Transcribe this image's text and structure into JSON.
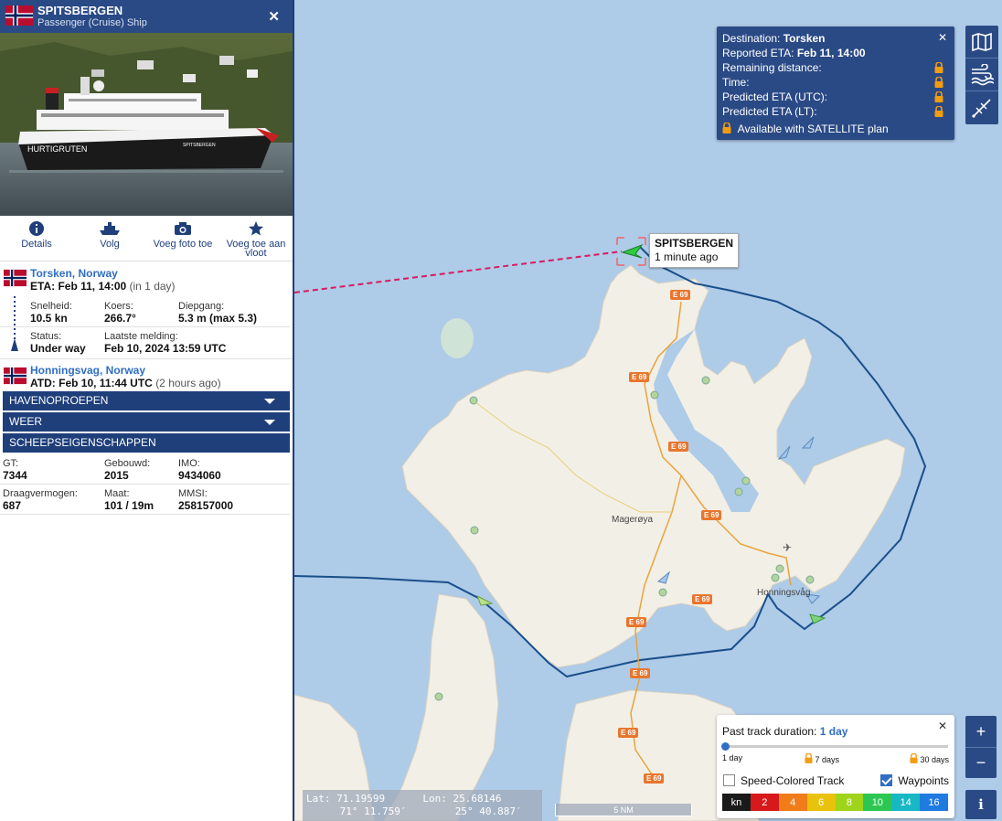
{
  "ship": {
    "name": "SPITSBERGEN",
    "type": "Passenger (Cruise) Ship",
    "photo_text_hull": "HURTIGRUTEN",
    "photo_text_name": "SPITSBERGEN"
  },
  "actions": [
    {
      "label": "Details",
      "icon": "info-icon"
    },
    {
      "label": "Volg",
      "icon": "ship-icon"
    },
    {
      "label": "Voeg foto toe",
      "icon": "camera-icon"
    },
    {
      "label": "Voeg toe aan vloot",
      "icon": "star-icon"
    }
  ],
  "destination": {
    "port": "Torsken, Norway",
    "eta_label": "ETA:",
    "eta": "Feb 11, 14:00",
    "eta_rel": "(in 1 day)"
  },
  "voyage": {
    "speed_label": "Snelheid:",
    "speed": "10.5 kn",
    "course_label": "Koers:",
    "course": "266.7°",
    "draught_label": "Diepgang:",
    "draught": "5.3 m (max 5.3)",
    "status_label": "Status:",
    "status": "Under way",
    "last_label": "Laatste melding:",
    "last": "Feb 10, 2024 13:59 UTC"
  },
  "departure": {
    "port": "Honningsvag, Norway",
    "atd_label": "ATD:",
    "atd": "Feb 10, 11:44 UTC",
    "atd_rel": "(2 hours ago)"
  },
  "sections": {
    "port_calls": "HAVENOPROEPEN",
    "weather": "WEER",
    "properties": "SCHEEPSEIGENSCHAPPEN"
  },
  "properties": {
    "gt_label": "GT:",
    "gt": "7344",
    "built_label": "Gebouwd:",
    "built": "2015",
    "imo_label": "IMO:",
    "imo": "9434060",
    "dwt_label": "Draagvermogen:",
    "dwt": "687",
    "size_label": "Maat:",
    "size": "101 / 19m",
    "mmsi_label": "MMSI:",
    "mmsi": "258157000"
  },
  "map_label": {
    "name": "SPITSBERGEN",
    "time": "1 minute ago"
  },
  "places": {
    "mageroya": "Magerøya",
    "honningsvag": "Honningsvåg",
    "road": "E 69"
  },
  "popup": {
    "dest_label": "Destination:",
    "dest": "Torsken",
    "eta_label": "Reported ETA:",
    "eta": "Feb 11, 14:00",
    "remaining": "Remaining distance:",
    "time": "Time:",
    "pred_utc": "Predicted ETA (UTC):",
    "pred_lt": "Predicted ETA (LT):",
    "plan": "Available with SATELLITE plan"
  },
  "track": {
    "title": "Past track duration:",
    "value": "1 day",
    "stop1": "1 day",
    "stop7": "7 days",
    "stop30": "30 days",
    "speed_colored": "Speed-Colored Track",
    "waypoints": "Waypoints",
    "legend": [
      "kn",
      "2",
      "4",
      "6",
      "8",
      "10",
      "14",
      "16"
    ]
  },
  "coords": {
    "lat_label": "Lat:",
    "lat": "71.19599",
    "lon_label": "Lon:",
    "lon": "25.68146",
    "lat_dms": "71° 11.759′",
    "lon_dms": "25° 40.887′"
  },
  "scale": "5 NM",
  "zoom": {
    "in": "+",
    "out": "−"
  },
  "info": "i",
  "colors": {
    "navy": "#2a4a86",
    "accent": "#2f6ec4",
    "sea": "#aecbe8",
    "land": "#f2efe6",
    "track": "#1a4f8a",
    "planned": "#d81b60",
    "ship": "#2ecc40",
    "lock": "#f39c12"
  }
}
